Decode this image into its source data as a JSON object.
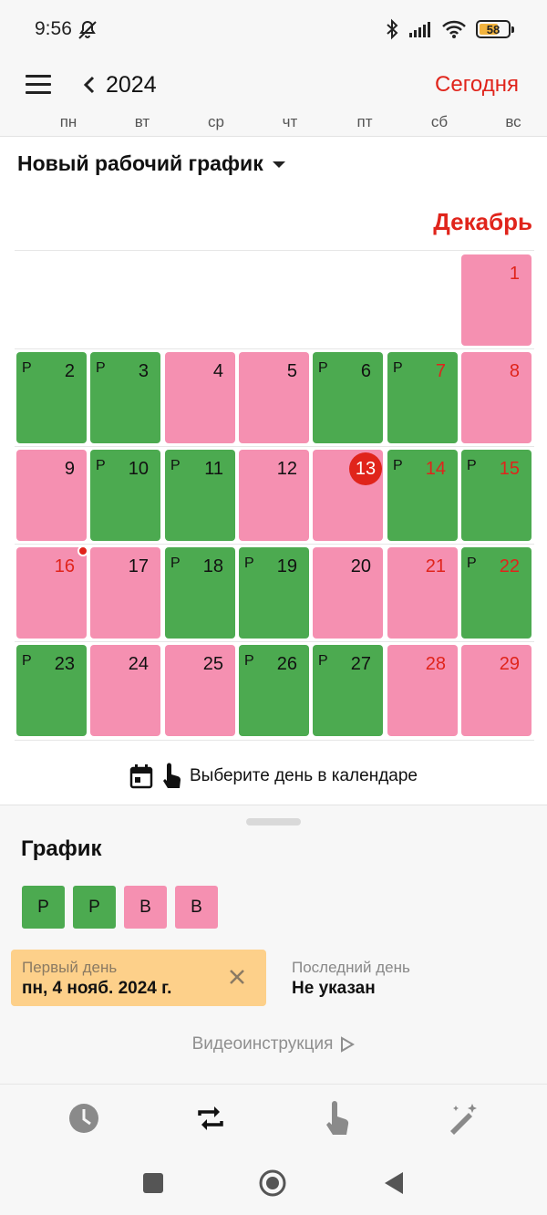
{
  "status_bar": {
    "time": "9:56",
    "battery": "58"
  },
  "header": {
    "year": "2024",
    "today_label": "Сегодня",
    "weekdays": [
      "пн",
      "вт",
      "ср",
      "чт",
      "пт",
      "сб",
      "вс"
    ]
  },
  "schedule": {
    "title": "Новый рабочий график"
  },
  "month": {
    "label": "Декабрь",
    "days": [
      {
        "num": "1",
        "type": "rest",
        "mark": "",
        "red": true
      },
      {
        "num": "2",
        "type": "work",
        "mark": "Р",
        "red": false
      },
      {
        "num": "3",
        "type": "work",
        "mark": "Р",
        "red": false
      },
      {
        "num": "4",
        "type": "rest",
        "mark": "",
        "red": false
      },
      {
        "num": "5",
        "type": "rest",
        "mark": "",
        "red": false
      },
      {
        "num": "6",
        "type": "work",
        "mark": "Р",
        "red": false
      },
      {
        "num": "7",
        "type": "work",
        "mark": "Р",
        "red": true
      },
      {
        "num": "8",
        "type": "rest",
        "mark": "",
        "red": true
      },
      {
        "num": "9",
        "type": "rest",
        "mark": "",
        "red": false
      },
      {
        "num": "10",
        "type": "work",
        "mark": "Р",
        "red": false
      },
      {
        "num": "11",
        "type": "work",
        "mark": "Р",
        "red": false
      },
      {
        "num": "12",
        "type": "rest",
        "mark": "",
        "red": false
      },
      {
        "num": "13",
        "type": "rest",
        "mark": "",
        "red": false,
        "today": true
      },
      {
        "num": "14",
        "type": "work",
        "mark": "Р",
        "red": true
      },
      {
        "num": "15",
        "type": "work",
        "mark": "Р",
        "red": true
      },
      {
        "num": "16",
        "type": "rest",
        "mark": "",
        "red": true,
        "event": true
      },
      {
        "num": "17",
        "type": "rest",
        "mark": "",
        "red": false
      },
      {
        "num": "18",
        "type": "work",
        "mark": "Р",
        "red": false
      },
      {
        "num": "19",
        "type": "work",
        "mark": "Р",
        "red": false
      },
      {
        "num": "20",
        "type": "rest",
        "mark": "",
        "red": false
      },
      {
        "num": "21",
        "type": "rest",
        "mark": "",
        "red": true
      },
      {
        "num": "22",
        "type": "work",
        "mark": "Р",
        "red": true
      },
      {
        "num": "23",
        "type": "work",
        "mark": "Р",
        "red": false
      },
      {
        "num": "24",
        "type": "rest",
        "mark": "",
        "red": false
      },
      {
        "num": "25",
        "type": "rest",
        "mark": "",
        "red": false
      },
      {
        "num": "26",
        "type": "work",
        "mark": "Р",
        "red": false
      },
      {
        "num": "27",
        "type": "work",
        "mark": "Р",
        "red": false
      },
      {
        "num": "28",
        "type": "rest",
        "mark": "",
        "red": true
      },
      {
        "num": "29",
        "type": "rest",
        "mark": "",
        "red": true
      }
    ]
  },
  "hint": {
    "text": "Выберите день в календаре"
  },
  "sheet": {
    "title": "График",
    "pattern": [
      {
        "label": "Р",
        "type": "work"
      },
      {
        "label": "Р",
        "type": "work"
      },
      {
        "label": "В",
        "type": "rest"
      },
      {
        "label": "В",
        "type": "rest"
      }
    ],
    "first_day_label": "Первый день",
    "first_day_value": "пн, 4 нояб. 2024 г.",
    "last_day_label": "Последний день",
    "last_day_value": "Не указан",
    "video_label": "Видеоинструкция"
  },
  "colors": {
    "work": "#4caa50",
    "rest": "#f590b1",
    "accent": "#e0241b",
    "first_day_bg": "#fdd08a"
  },
  "nav_icons": [
    "clock-icon",
    "repeat-icon",
    "touch-icon",
    "magic-wand-icon"
  ]
}
